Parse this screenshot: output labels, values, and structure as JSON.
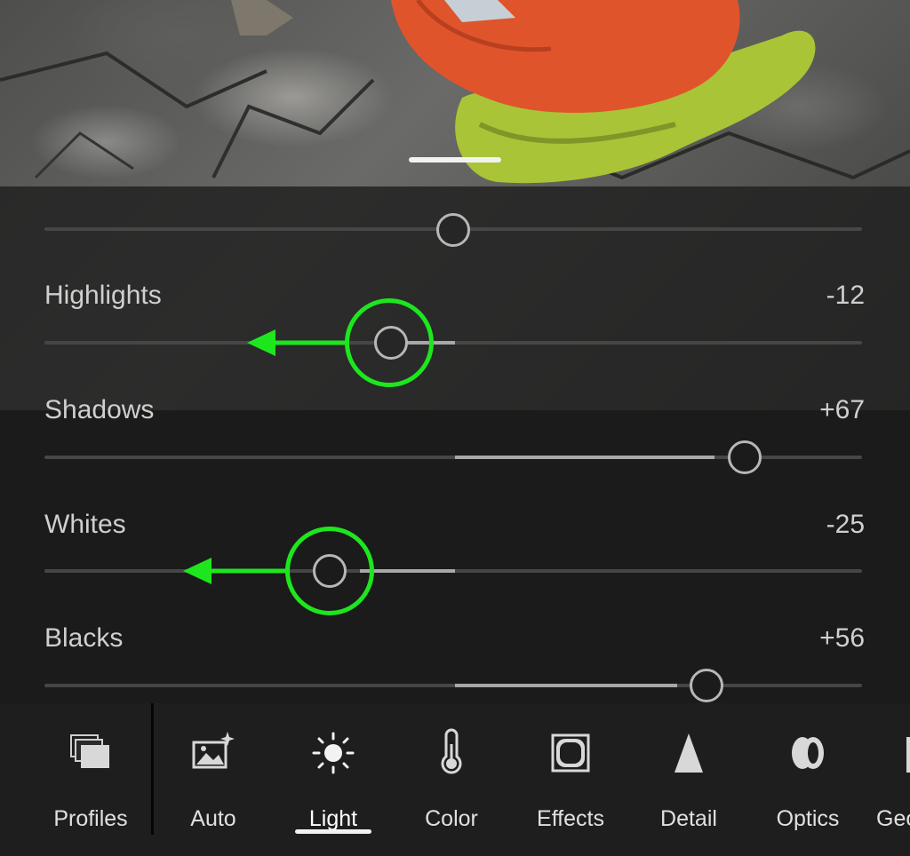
{
  "sliders": [
    {
      "label": "",
      "value": "",
      "position": 0.5
    },
    {
      "label": "Highlights",
      "value": "-12",
      "position": 0.44
    },
    {
      "label": "Shadows",
      "value": "+67",
      "position": 0.835
    },
    {
      "label": "Whites",
      "value": "-25",
      "position": 0.375
    },
    {
      "label": "Blacks",
      "value": "+56",
      "position": 0.785
    }
  ],
  "toolbar": {
    "items": [
      {
        "label": "Profiles",
        "icon": "profiles-icon"
      },
      {
        "label": "Auto",
        "icon": "auto-icon"
      },
      {
        "label": "Light",
        "icon": "light-icon",
        "selected": true
      },
      {
        "label": "Color",
        "icon": "color-icon"
      },
      {
        "label": "Effects",
        "icon": "effects-icon"
      },
      {
        "label": "Detail",
        "icon": "detail-icon"
      },
      {
        "label": "Optics",
        "icon": "optics-icon"
      },
      {
        "label": "Geo",
        "icon": "geometry-icon"
      }
    ]
  },
  "colors": {
    "annotation_green": "#1ee61e",
    "panel_background": "#1b1b1b",
    "slider_track": "#464646",
    "slider_fill": "#a8a8a8"
  }
}
